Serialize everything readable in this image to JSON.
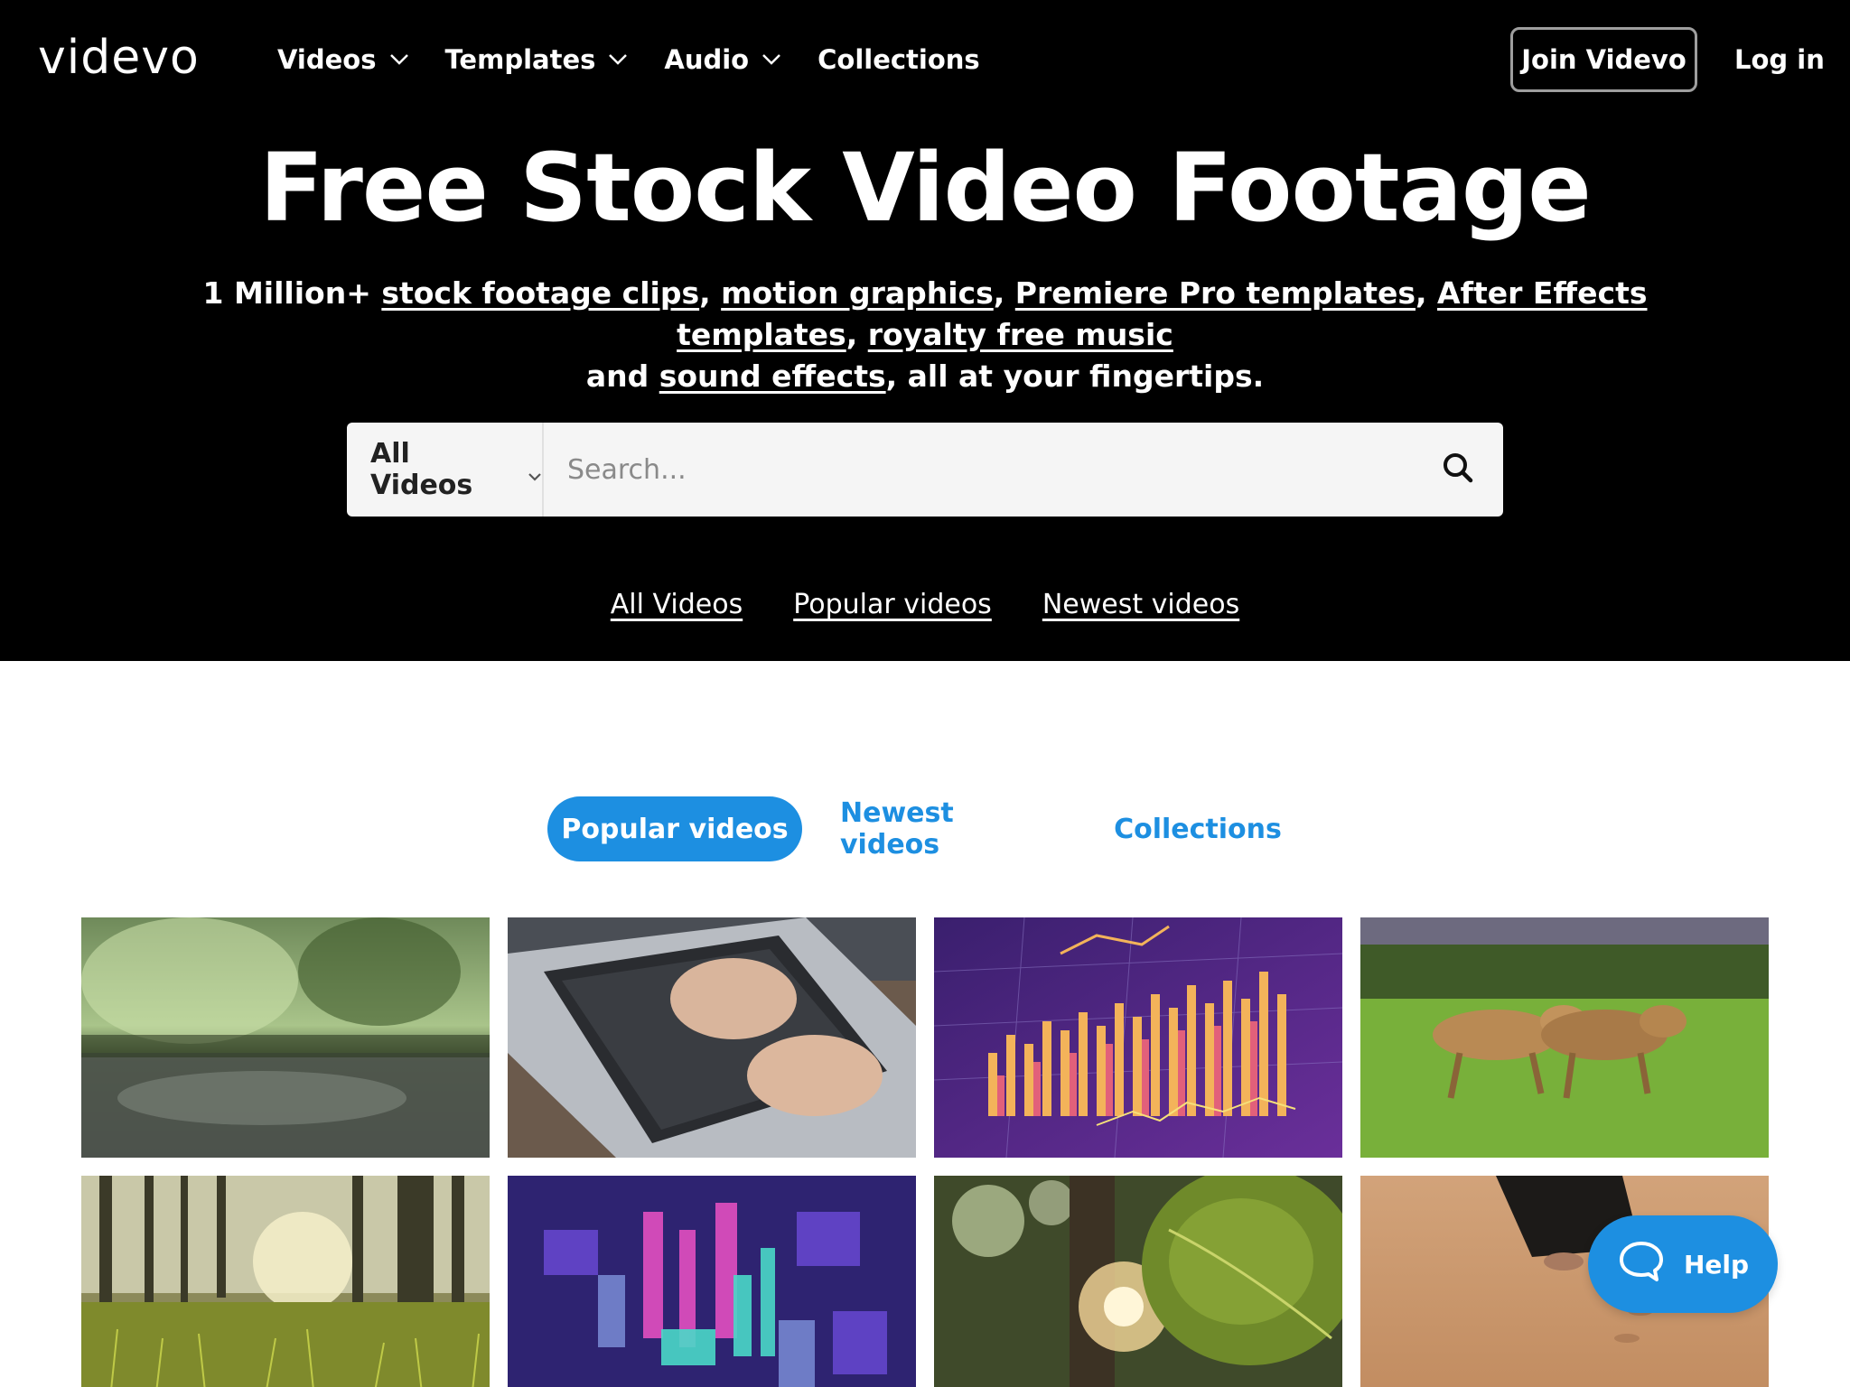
{
  "header": {
    "logo": "videvo",
    "nav": [
      {
        "label": "Videos",
        "has_dropdown": true
      },
      {
        "label": "Templates",
        "has_dropdown": true
      },
      {
        "label": "Audio",
        "has_dropdown": true
      },
      {
        "label": "Collections",
        "has_dropdown": false
      }
    ],
    "join_label": "Join Videvo",
    "login_label": "Log in"
  },
  "hero": {
    "title": "Free Stock Video Footage",
    "subtitle": {
      "prefix": "1 Million+ ",
      "links": [
        "stock footage clips",
        "motion graphics",
        "Premiere Pro templates",
        "After Effects templates",
        "royalty free music"
      ],
      "middle": "and ",
      "link_last": "sound effects",
      "suffix": ", all at your fingertips."
    },
    "search": {
      "category": "All Videos",
      "placeholder": "Search..."
    },
    "quick_links": [
      "All Videos",
      "Popular videos",
      "Newest videos"
    ]
  },
  "tabs": [
    {
      "label": "Popular videos",
      "active": true
    },
    {
      "label": "Newest videos",
      "active": false
    },
    {
      "label": "Collections",
      "active": false
    }
  ],
  "videos": [
    {
      "subject": "rain-puddle-forest"
    },
    {
      "subject": "typing-on-laptop"
    },
    {
      "subject": "financial-bar-chart-hologram"
    },
    {
      "subject": "lionesses-walking-grass"
    },
    {
      "subject": "sunlit-forest-grass"
    },
    {
      "subject": "digital-data-city"
    },
    {
      "subject": "jungle-leaf-sunlight"
    },
    {
      "subject": "walking-on-desert-sand"
    }
  ],
  "help": {
    "label": "Help"
  },
  "colors": {
    "accent": "#1d8fe1",
    "hero_bg": "#000000",
    "search_bg": "#f5f5f5"
  }
}
